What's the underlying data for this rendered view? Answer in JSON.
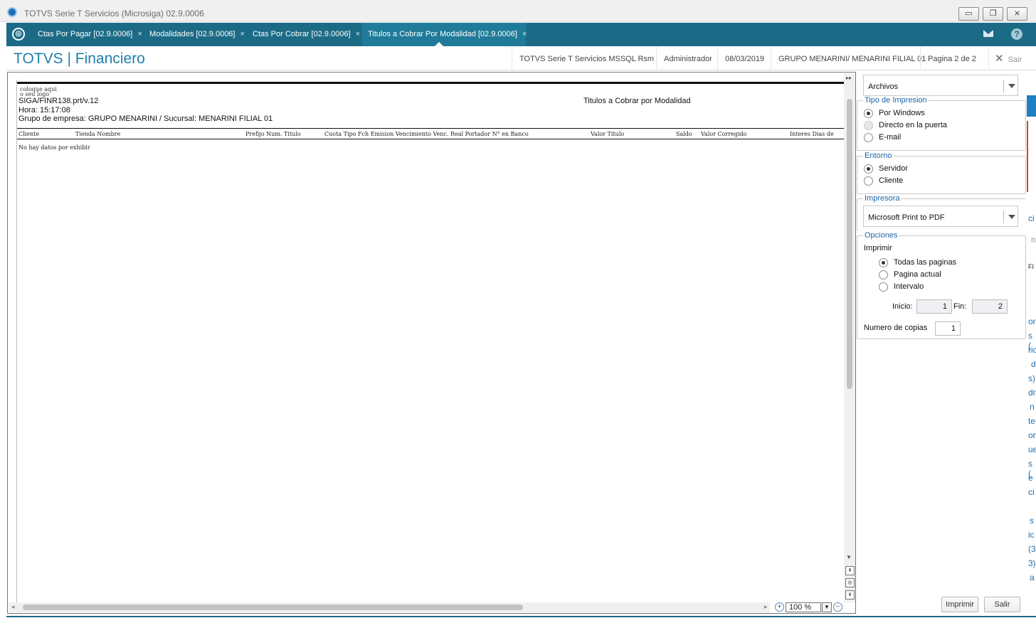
{
  "window": {
    "title": "TOTVS Serie T Servicios (Microsiga) 02.9.0006",
    "minimize": "▭",
    "restore": "❐",
    "close": "⨯"
  },
  "tabs": [
    {
      "label": "Ctas Por Pagar [02.9.0006]",
      "close": "×"
    },
    {
      "label": "Modalidades [02.9.0006]",
      "close": "×"
    },
    {
      "label": "Ctas Por Cobrar [02.9.0006]",
      "close": "×"
    },
    {
      "label": "Titulos a Cobrar Por Modalidad [02.9.0006]",
      "close": "×"
    }
  ],
  "tabbar": {
    "help": "?"
  },
  "header": {
    "brand": "TOTVS | Financiero",
    "environment": "TOTVS Serie T Servicios MSSQL Rsm",
    "user": "Administrador",
    "date": "08/03/2019",
    "company": "GRUPO MENARINI/ MENARINI FILIAL 01",
    "page": "Pagina 2 de 2",
    "exit": "Sair"
  },
  "report": {
    "logo": "coloque aqui\no seu logo",
    "program": "SIGA/FINR138.prt/v.12",
    "hour": "Hora: 15:17:08",
    "company_line": "Grupo de empresa: GRUPO MENARINI / Sucursal: MENARINI FILIAL 01",
    "title": "Titulos a Cobrar por Modalidad",
    "columns": [
      "Cliente",
      "Tienda Nombre",
      "Prefijo Num. Titulo",
      "Cuota Tipo Fch Emision Vencimiento Venc. Real Portador N° en Banco",
      "Valor Titulo",
      "Saldo",
      "Valor Corregido",
      "Interes Dias de"
    ],
    "no_data": "No hay datos por exhibir"
  },
  "viewer": {
    "zoom": "100 %"
  },
  "panel": {
    "output_combo": "Archivos",
    "tipo_impresion": {
      "legend": "Tipo de Impresion",
      "options": [
        "Por Windows",
        "Directo en la puerta",
        "E-mail"
      ],
      "selected": "Por Windows"
    },
    "entorno": {
      "legend": "Entorno",
      "options": [
        "Servidor",
        "Cliente"
      ],
      "selected": "Servidor"
    },
    "impresora": {
      "legend": "Impresora",
      "value": "Microsoft Print to PDF"
    },
    "opciones": {
      "legend": "Opciones",
      "imprimir_label": "Imprimir",
      "options": [
        "Todas las paginas",
        "Pagina actual",
        "Intervalo"
      ],
      "selected": "Todas las paginas",
      "inicio_label": "Inicio:",
      "inicio_value": "1",
      "fin_label": "Fin:",
      "fin_value": "2",
      "copias_label": "Numero de copias",
      "copias_value": "1"
    },
    "print_button": "Imprimir",
    "exit_button": "Salir"
  },
  "background_fragments": [
    "S",
    "ci",
    "n",
    "FI",
    "or",
    "s (",
    "ric",
    "d",
    "s)",
    "dr",
    "n",
    "te",
    "or",
    "ue",
    "s (",
    "e",
    "ci",
    "s",
    "ic",
    "(3",
    "3)",
    "a"
  ]
}
